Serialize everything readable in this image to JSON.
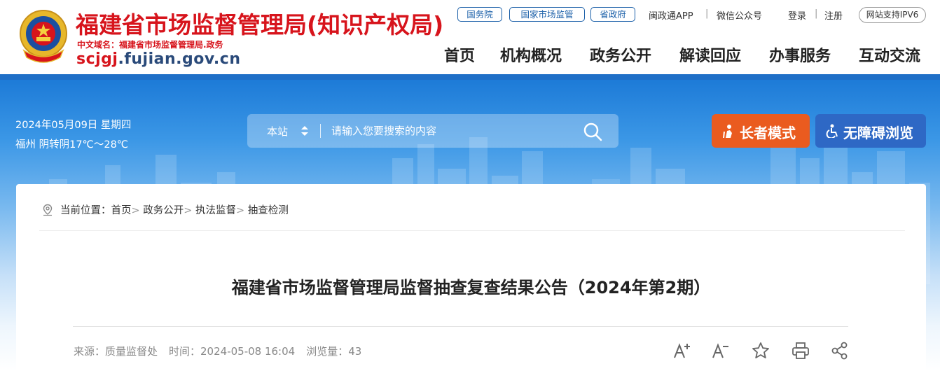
{
  "header": {
    "site_title": "福建省市场监督管理局(知识产权局)",
    "cn_domain": "中文域名：福建省市场监督管理局.政务",
    "domain_red": "scjgj",
    "domain_blue": ".fujian.gov.cn",
    "top_pills": [
      "国务院",
      "国家市场监管",
      "省政府"
    ],
    "top_links": [
      "闽政通APP",
      "微信公众号",
      "登录",
      "注册"
    ],
    "ipv6": "网站支持IPV6",
    "nav": [
      "首页",
      "机构概况",
      "政务公开",
      "解读回应",
      "办事服务",
      "互动交流"
    ]
  },
  "banner": {
    "date": "2024年05月09日 星期四",
    "weather": "福州 阴转阴17℃～28℃",
    "search_scope": "本站",
    "search_placeholder": "请输入您要搜索的内容",
    "elder_mode": "长者模式",
    "accessible": "无障碍浏览"
  },
  "breadcrumb": {
    "prefix": "当前位置：",
    "items": [
      "首页",
      "政务公开",
      "执法监督",
      "抽查检测"
    ]
  },
  "article": {
    "title": "福建省市场监督管理局监督抽查复查结果公告（2024年第2期）",
    "source": "来源：质量监督处",
    "time": "时间：2024-05-08 16:04",
    "views": "浏览量：43"
  },
  "colors": {
    "brand_red": "#d7141c",
    "elder_orange": "#ea5b1f",
    "access_blue": "#2e68c5",
    "link_blue": "#1a5fa8"
  }
}
